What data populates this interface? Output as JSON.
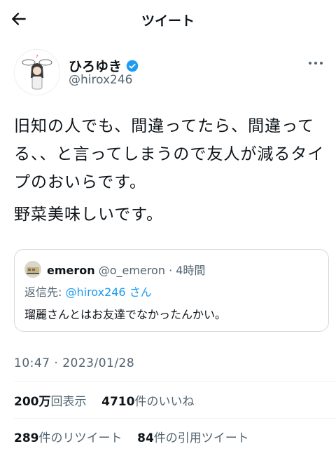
{
  "header": {
    "title": "ツイート"
  },
  "author": {
    "name": "ひろゆき",
    "handle": "@hirox246"
  },
  "tweet": {
    "text1": "旧知の人でも、間違ってたら、間違ってる、、と言ってしまうので友人が減るタイプのおいらです。",
    "text2": "野菜美味しいです。"
  },
  "quote": {
    "name": "emeron",
    "handle": "@o_emeron",
    "separator": "·",
    "time": "4時間",
    "reply_prefix": "返信先: ",
    "reply_handle": "@hirox246",
    "reply_suffix": " さん",
    "text": "瑠麗さんとはお友達でなかったんかい。"
  },
  "timestamp": "10:47 · 2023/01/28",
  "stats": {
    "views_value": "200万",
    "views_label": "回表示",
    "likes_value": "4710",
    "likes_label": "件のいいね",
    "retweets_value": "289",
    "retweets_label": "件のリツイート",
    "quotes_value": "84",
    "quotes_label": "件の引用ツイート"
  },
  "colors": {
    "accent": "#1d9bf0",
    "text": "#0f1419",
    "muted": "#536471",
    "border": "#cfd9de"
  }
}
